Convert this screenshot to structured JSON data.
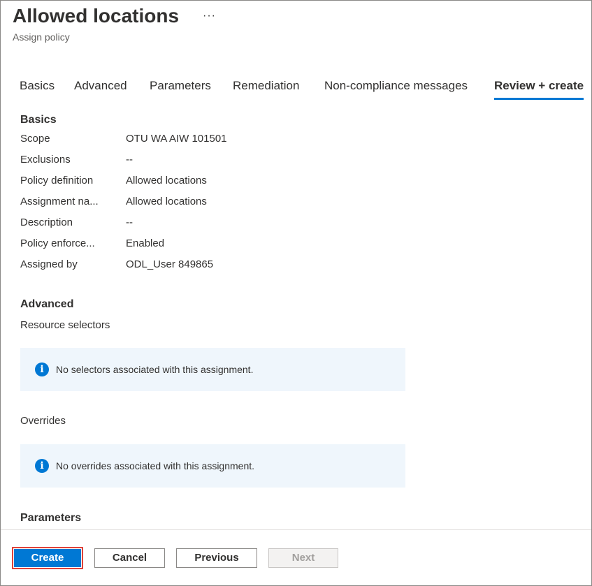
{
  "header": {
    "title": "Allowed locations",
    "more_glyph": "···",
    "subtitle": "Assign policy"
  },
  "tabs": [
    {
      "label": "Basics",
      "active": false
    },
    {
      "label": "Advanced",
      "active": false
    },
    {
      "label": "Parameters",
      "active": false
    },
    {
      "label": "Remediation",
      "active": false
    },
    {
      "label": "Non-compliance messages",
      "active": false
    },
    {
      "label": "Review + create",
      "active": true
    }
  ],
  "basics": {
    "title": "Basics",
    "rows": [
      {
        "label": "Scope",
        "value": "OTU WA AIW 101501"
      },
      {
        "label": "Exclusions",
        "value": "--"
      },
      {
        "label": "Policy definition",
        "value": "Allowed locations"
      },
      {
        "label": "Assignment na...",
        "value": "Allowed locations"
      },
      {
        "label": "Description",
        "value": "--"
      },
      {
        "label": "Policy enforce...",
        "value": "Enabled"
      },
      {
        "label": "Assigned by",
        "value": "ODL_User 849865"
      }
    ]
  },
  "advanced": {
    "title": "Advanced",
    "resource_selectors_label": "Resource selectors",
    "selectors_info": "No selectors associated with this assignment.",
    "overrides_label": "Overrides",
    "overrides_info": "No overrides associated with this assignment.",
    "info_icon_glyph": "i"
  },
  "parameters": {
    "title": "Parameters"
  },
  "footer": {
    "create_label": "Create",
    "cancel_label": "Cancel",
    "previous_label": "Previous",
    "next_label": "Next",
    "next_disabled": true
  },
  "colors": {
    "accent": "#0078d4",
    "highlight_outline": "#e0423a",
    "info_background": "#eff6fc",
    "text": "#323130"
  }
}
